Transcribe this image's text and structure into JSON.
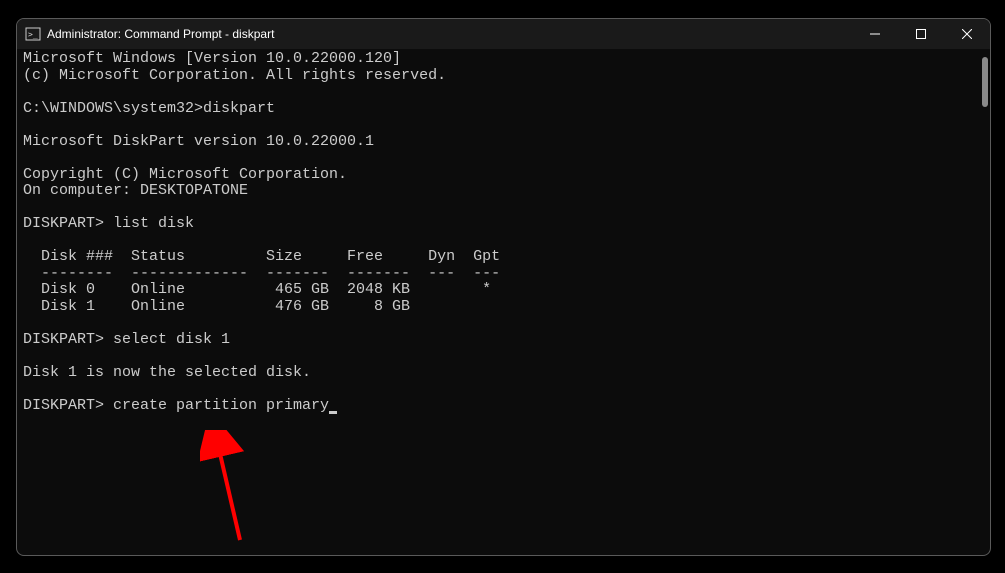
{
  "titlebar": {
    "title": "Administrator: Command Prompt - diskpart"
  },
  "terminal": {
    "line1": "Microsoft Windows [Version 10.0.22000.120]",
    "line2": "(c) Microsoft Corporation. All rights reserved.",
    "blank1": "",
    "line3": "C:\\WINDOWS\\system32>diskpart",
    "blank2": "",
    "line4": "Microsoft DiskPart version 10.0.22000.1",
    "blank3": "",
    "line5": "Copyright (C) Microsoft Corporation.",
    "line6": "On computer: DESKTOPATONE",
    "blank4": "",
    "line7": "DISKPART> list disk",
    "blank5": "",
    "line8": "  Disk ###  Status         Size     Free     Dyn  Gpt",
    "line9": "  --------  -------------  -------  -------  ---  ---",
    "line10": "  Disk 0    Online          465 GB  2048 KB        *",
    "line11": "  Disk 1    Online          476 GB     8 GB",
    "blank6": "",
    "line12": "DISKPART> select disk 1",
    "blank7": "",
    "line13": "Disk 1 is now the selected disk.",
    "blank8": "",
    "line14": "DISKPART> create partition primary"
  }
}
